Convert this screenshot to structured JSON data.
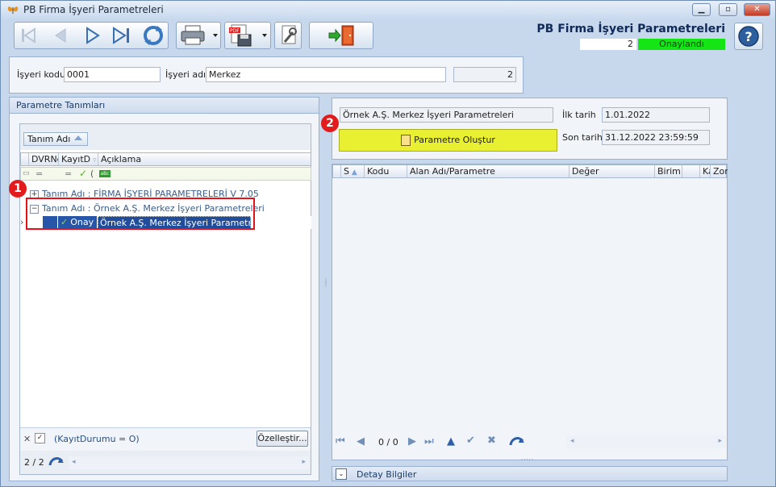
{
  "window": {
    "title": "PB Firma İşyeri Parametreleri",
    "minimize_label": "▁",
    "maximize_label": "▫",
    "close_label": "✕"
  },
  "header": {
    "title": "PB Firma İşyeri Parametreleri",
    "record_count": "2",
    "status": "Onaylandı",
    "status_color": "#15e415"
  },
  "form": {
    "code_label": "İşyeri kodu",
    "code_value": "0001",
    "name_label": "İşyeri adı",
    "name_value": "Merkez",
    "number_value": "2"
  },
  "left_panel": {
    "title": "Parametre Tanımları",
    "group_chip": "Tanım Adı",
    "columns": [
      "DVRNo",
      "KayıtD",
      "Açıklama"
    ],
    "groups": [
      {
        "label": "Tanım Adı : FİRMA İŞYERİ PARAMETRELERİ V 7.05",
        "expander": "+"
      },
      {
        "label": "Tanım Adı : Örnek A.Ş. Merkez İşyeri Parametreleri",
        "expander": "−"
      }
    ],
    "selected_row": {
      "status": "Onay",
      "description": "Örnek A.Ş. Merkez İşyeri Parametreleri"
    },
    "filter_text": "(KayıtDurumu = O)",
    "customize_label": "Özelleştir...",
    "page_info": "2 / 2"
  },
  "right_panel": {
    "param_name": "Örnek A.Ş. Merkez İşyeri Parametreleri",
    "start_label": "İlk tarih",
    "start_value": "1.01.2022",
    "end_label": "Son tarih",
    "end_value": "31.12.2022 23:59:59",
    "create_button": "Parametre Oluştur",
    "columns": [
      "S",
      "Kodu",
      "Alan Adı/Parametre",
      "Değer",
      "Birim",
      "Ka",
      "Zor"
    ],
    "page_info": "0 / 0",
    "detail_label": "Detay Bilgiler"
  },
  "badges": [
    "1",
    "2"
  ],
  "icons": {
    "app": "butterfly-icon",
    "nav_first": "first-record-icon",
    "nav_prev": "previous-record-icon",
    "nav_next": "next-record-icon",
    "nav_last": "last-record-icon",
    "refresh": "refresh-icon",
    "print": "printer-icon",
    "export": "pdf-export-icon",
    "tools": "tools-icon",
    "exit": "exit-door-icon",
    "help": "help-icon"
  }
}
